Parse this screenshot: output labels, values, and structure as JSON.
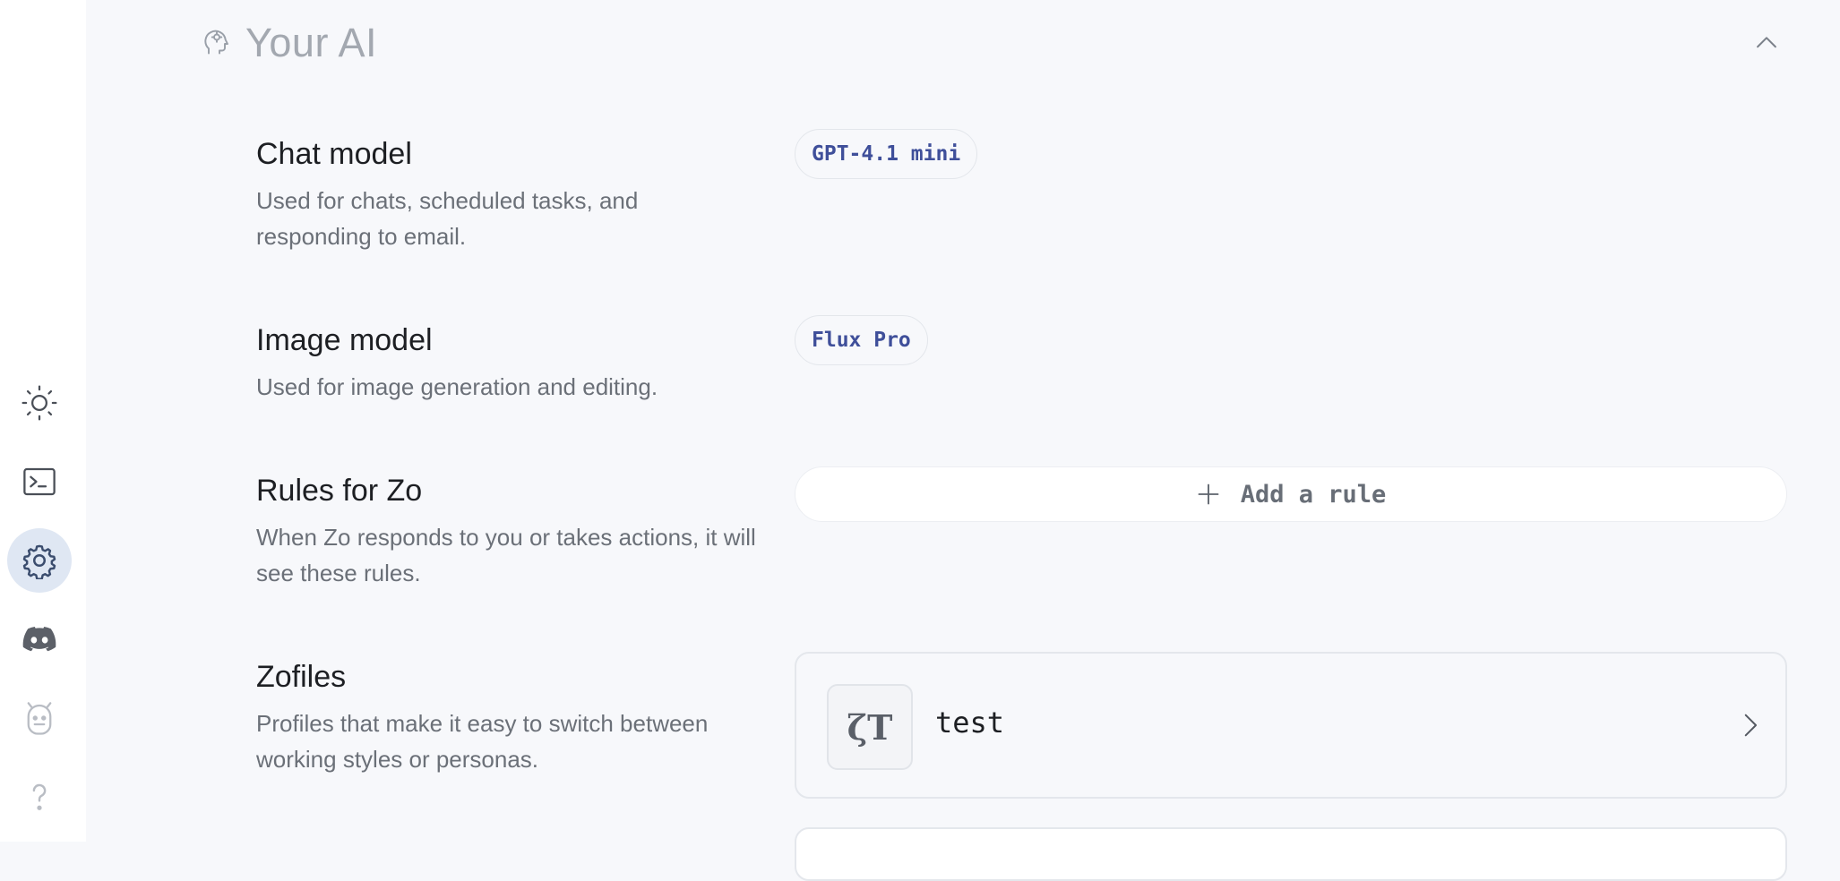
{
  "rail": {
    "items": [
      {
        "name": "theme-toggle",
        "icon": "sun-icon"
      },
      {
        "name": "terminal",
        "icon": "terminal-icon"
      },
      {
        "name": "settings",
        "icon": "gear-icon",
        "active": true
      },
      {
        "name": "discord",
        "icon": "discord-icon"
      },
      {
        "name": "bot",
        "icon": "robot-icon"
      },
      {
        "name": "help",
        "icon": "question-icon"
      }
    ]
  },
  "section": {
    "title": "Your AI",
    "icon": "head-brain-icon",
    "collapse_icon": "chevron-up-icon"
  },
  "chat_model": {
    "title": "Chat model",
    "description": "Used for chats, scheduled tasks, and responding to email.",
    "value": "GPT-4.1 mini"
  },
  "image_model": {
    "title": "Image model",
    "description": "Used for image generation and editing.",
    "value": "Flux Pro"
  },
  "rules": {
    "title": "Rules for Zo",
    "description": "When Zo responds to you or takes actions, it will see these rules.",
    "add_label": "Add a rule",
    "add_icon": "plus-icon"
  },
  "zofiles": {
    "title": "Zofiles",
    "description": "Profiles that make it easy to switch between working styles or personas.",
    "items": [
      {
        "avatar": "ζT",
        "name": "test"
      }
    ]
  },
  "colors": {
    "accent_active": "#dfe7f3",
    "pill_text": "#3f4f9a",
    "background": "#f7f8fb"
  }
}
